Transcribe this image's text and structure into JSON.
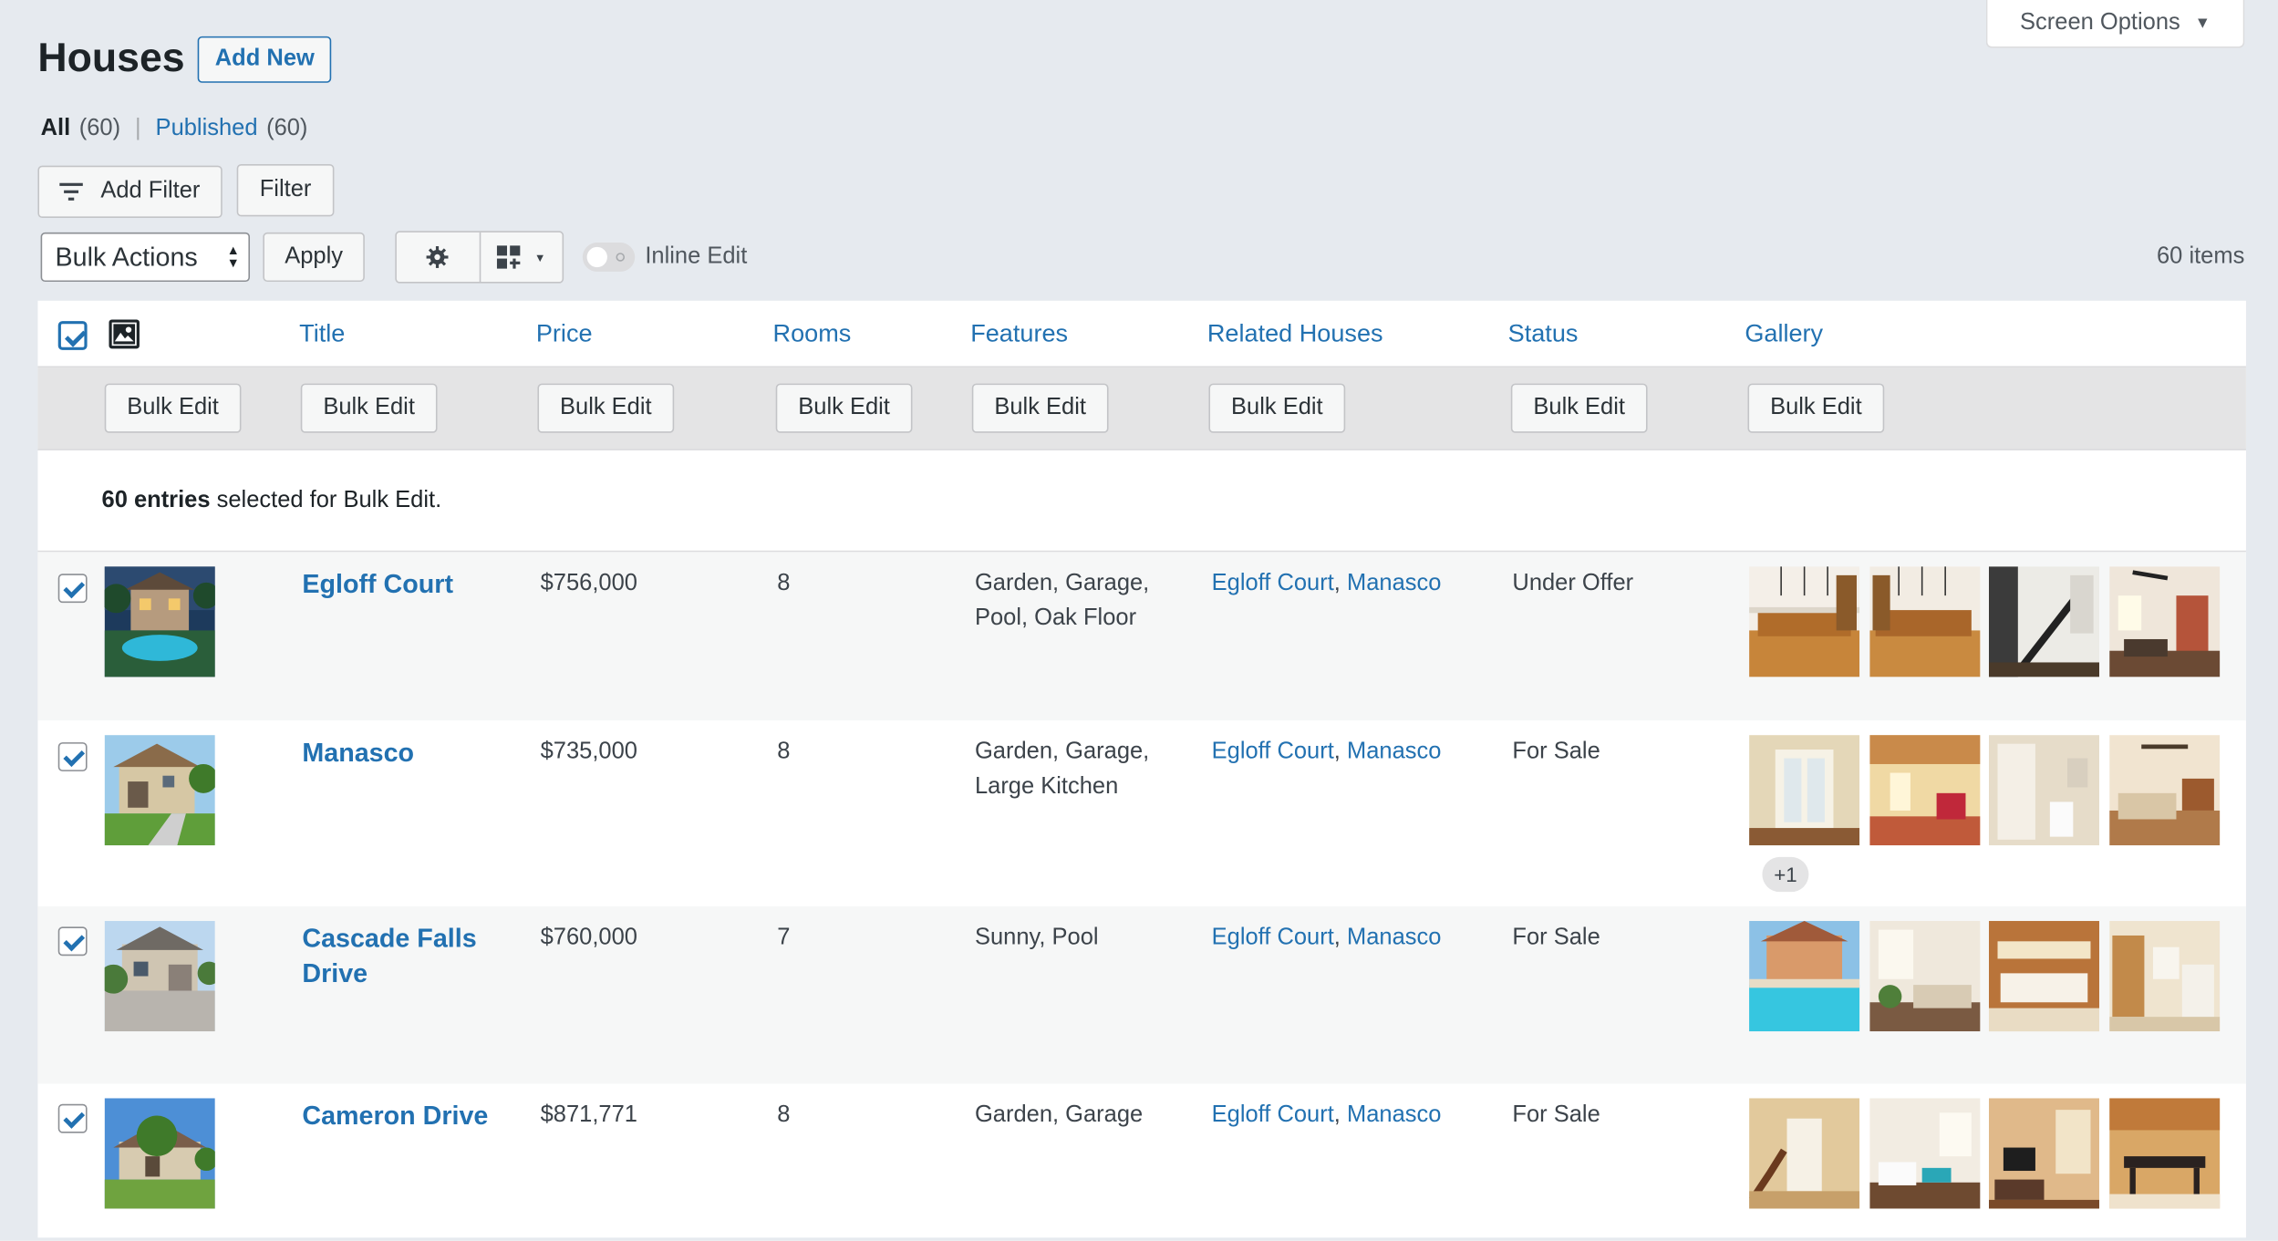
{
  "screen_options": {
    "label": "Screen Options"
  },
  "page": {
    "title": "Houses",
    "add_new": "Add New"
  },
  "views": {
    "all_label": "All",
    "all_count": "(60)",
    "separator": "|",
    "published_label": "Published",
    "published_count": "(60)"
  },
  "filters": {
    "add_filter": "Add Filter",
    "filter": "Filter"
  },
  "toolbar": {
    "bulk_actions": "Bulk Actions",
    "apply": "Apply",
    "inline_edit": "Inline Edit",
    "items_count": "60 items"
  },
  "columns": [
    "Title",
    "Price",
    "Rooms",
    "Features",
    "Related Houses",
    "Status",
    "Gallery"
  ],
  "bulk_edit_label": "Bulk Edit",
  "selection": {
    "count_text": "60 entries",
    "rest_text": " selected for Bulk Edit."
  },
  "rows": [
    {
      "title_line1": "Egloff Court",
      "title_line2": "",
      "price": "$756,000",
      "rooms": "8",
      "features_line1": "Garden, Garage,",
      "features_line2": "Pool, Oak Floor",
      "related": [
        "Egloff Court",
        "Manasco"
      ],
      "status": "Under Offer",
      "gallery_extra": ""
    },
    {
      "title_line1": "Manasco",
      "title_line2": "",
      "price": "$735,000",
      "rooms": "8",
      "features_line1": "Garden, Garage,",
      "features_line2": "Large Kitchen",
      "related": [
        "Egloff Court",
        "Manasco"
      ],
      "status": "For Sale",
      "gallery_extra": "+1"
    },
    {
      "title_line1": "Cascade Falls",
      "title_line2": "Drive",
      "price": "$760,000",
      "rooms": "7",
      "features_line1": "Sunny, Pool",
      "features_line2": "",
      "related": [
        "Egloff Court",
        "Manasco"
      ],
      "status": "For Sale",
      "gallery_extra": ""
    },
    {
      "title_line1": "Cameron Drive",
      "title_line2": "",
      "price": "$871,771",
      "rooms": "8",
      "features_line1": "Garden, Garage",
      "features_line2": "",
      "related": [
        "Egloff Court",
        "Manasco"
      ],
      "status": "For Sale",
      "gallery_extra": ""
    }
  ],
  "related_separator": ","
}
